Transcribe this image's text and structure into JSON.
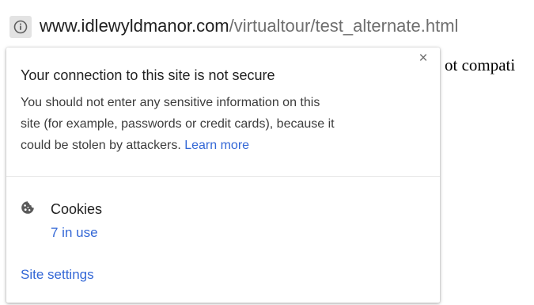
{
  "omnibox": {
    "url_host": "www.idlewyldmanor.com",
    "url_path": "/virtualtour/test_alternate.html",
    "icon": "info-icon"
  },
  "page": {
    "partial_text": "ot compati"
  },
  "popup": {
    "close_label": "×",
    "title": "Your connection to this site is not secure",
    "body_line1": "You should not enter any sensitive information on this",
    "body_line2": "site (for example, passwords or credit cards), because it",
    "body_line3": "could be stolen by attackers. ",
    "learn_more": "Learn more",
    "cookies": {
      "icon": "cookie-icon",
      "label": "Cookies",
      "count": "7 in use"
    },
    "site_settings": "Site settings"
  },
  "colors": {
    "link": "#3367d6",
    "title": "#212121",
    "body": "#3c3c3c"
  }
}
